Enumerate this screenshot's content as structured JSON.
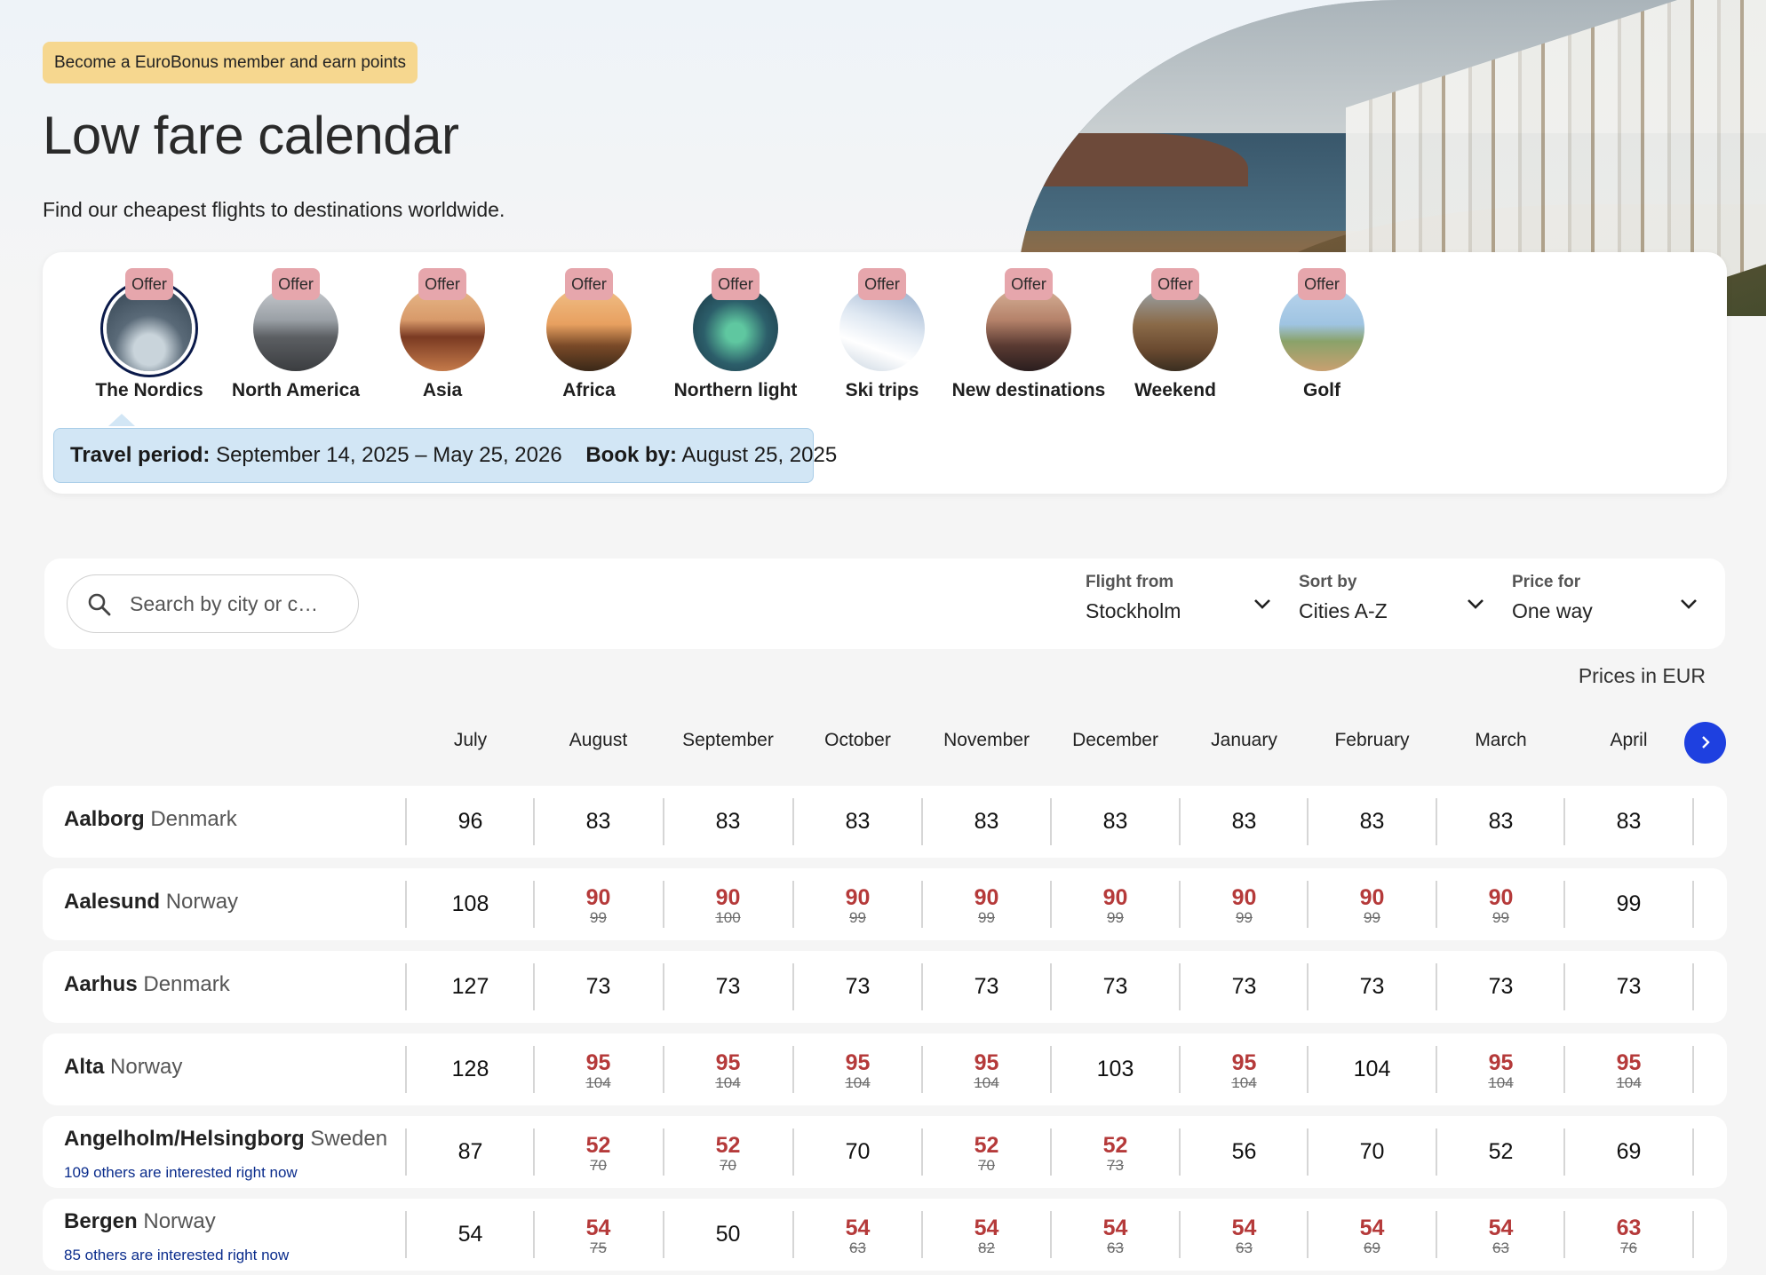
{
  "header": {
    "member_badge": "Become a EuroBonus member and earn points",
    "title": "Low fare calendar",
    "subtitle": "Find our cheapest flights to destinations worldwide."
  },
  "categories": [
    {
      "label": "The Nordics",
      "tag": "Offer",
      "selected": true,
      "thumb": "nordics-image"
    },
    {
      "label": "North America",
      "tag": "Offer",
      "thumb": "north-america-image"
    },
    {
      "label": "Asia",
      "tag": "Offer",
      "thumb": "asia-image"
    },
    {
      "label": "Africa",
      "tag": "Offer",
      "thumb": "africa-image"
    },
    {
      "label": "Northern light",
      "tag": "Offer",
      "thumb": "northern-light-image"
    },
    {
      "label": "Ski trips",
      "tag": "Offer",
      "thumb": "ski-trips-image"
    },
    {
      "label": "New destinations",
      "tag": "Offer",
      "thumb": "new-destinations-image"
    },
    {
      "label": "Weekend",
      "tag": "Offer",
      "thumb": "weekend-image"
    },
    {
      "label": "Golf",
      "tag": "Offer",
      "thumb": "golf-image"
    }
  ],
  "travel_info": {
    "period_label": "Travel period:",
    "period_value": "September 14, 2025 – May 25, 2026",
    "book_label": "Book by:",
    "book_value": "August 25, 2025"
  },
  "filters": {
    "search_placeholder": "Search by city or c…",
    "flight_from": {
      "label": "Flight from",
      "value": "Stockholm"
    },
    "sort_by": {
      "label": "Sort by",
      "value": "Cities A-Z"
    },
    "price_for": {
      "label": "Price for",
      "value": "One way"
    }
  },
  "prices_note": "Prices in EUR",
  "months": [
    "July",
    "August",
    "September",
    "October",
    "November",
    "December",
    "January",
    "February",
    "March",
    "April"
  ],
  "rows": [
    {
      "city": "Aalborg",
      "country": "Denmark",
      "interest": "",
      "prices": [
        {
          "v": "96"
        },
        {
          "v": "83"
        },
        {
          "v": "83"
        },
        {
          "v": "83"
        },
        {
          "v": "83"
        },
        {
          "v": "83"
        },
        {
          "v": "83"
        },
        {
          "v": "83"
        },
        {
          "v": "83"
        },
        {
          "v": "83"
        }
      ]
    },
    {
      "city": "Aalesund",
      "country": "Norway",
      "interest": "",
      "prices": [
        {
          "v": "108"
        },
        {
          "v": "90",
          "old": "99"
        },
        {
          "v": "90",
          "old": "100"
        },
        {
          "v": "90",
          "old": "99"
        },
        {
          "v": "90",
          "old": "99"
        },
        {
          "v": "90",
          "old": "99"
        },
        {
          "v": "90",
          "old": "99"
        },
        {
          "v": "90",
          "old": "99"
        },
        {
          "v": "90",
          "old": "99"
        },
        {
          "v": "99"
        }
      ]
    },
    {
      "city": "Aarhus",
      "country": "Denmark",
      "interest": "",
      "prices": [
        {
          "v": "127"
        },
        {
          "v": "73"
        },
        {
          "v": "73"
        },
        {
          "v": "73"
        },
        {
          "v": "73"
        },
        {
          "v": "73"
        },
        {
          "v": "73"
        },
        {
          "v": "73"
        },
        {
          "v": "73"
        },
        {
          "v": "73"
        }
      ]
    },
    {
      "city": "Alta",
      "country": "Norway",
      "interest": "",
      "prices": [
        {
          "v": "128"
        },
        {
          "v": "95",
          "old": "104"
        },
        {
          "v": "95",
          "old": "104"
        },
        {
          "v": "95",
          "old": "104"
        },
        {
          "v": "95",
          "old": "104"
        },
        {
          "v": "103"
        },
        {
          "v": "95",
          "old": "104"
        },
        {
          "v": "104"
        },
        {
          "v": "95",
          "old": "104"
        },
        {
          "v": "95",
          "old": "104"
        }
      ]
    },
    {
      "city": "Angelholm/Helsingborg",
      "country": "Sweden",
      "interest": "109 others are interested right now",
      "prices": [
        {
          "v": "87"
        },
        {
          "v": "52",
          "old": "70"
        },
        {
          "v": "52",
          "old": "70"
        },
        {
          "v": "70"
        },
        {
          "v": "52",
          "old": "70"
        },
        {
          "v": "52",
          "old": "73"
        },
        {
          "v": "56"
        },
        {
          "v": "70"
        },
        {
          "v": "52"
        },
        {
          "v": "69"
        }
      ]
    },
    {
      "city": "Bergen",
      "country": "Norway",
      "interest": "85 others are interested right now",
      "prices": [
        {
          "v": "54"
        },
        {
          "v": "54",
          "old": "75"
        },
        {
          "v": "50"
        },
        {
          "v": "54",
          "old": "63"
        },
        {
          "v": "54",
          "old": "82"
        },
        {
          "v": "54",
          "old": "63"
        },
        {
          "v": "54",
          "old": "63"
        },
        {
          "v": "54",
          "old": "69"
        },
        {
          "v": "54",
          "old": "63"
        },
        {
          "v": "63",
          "old": "76"
        }
      ]
    }
  ],
  "colors": {
    "offer_price": "#b53a3a",
    "accent": "#1e40e0",
    "badge": "#f6d78f",
    "offer_tag": "#e6a6ac"
  }
}
